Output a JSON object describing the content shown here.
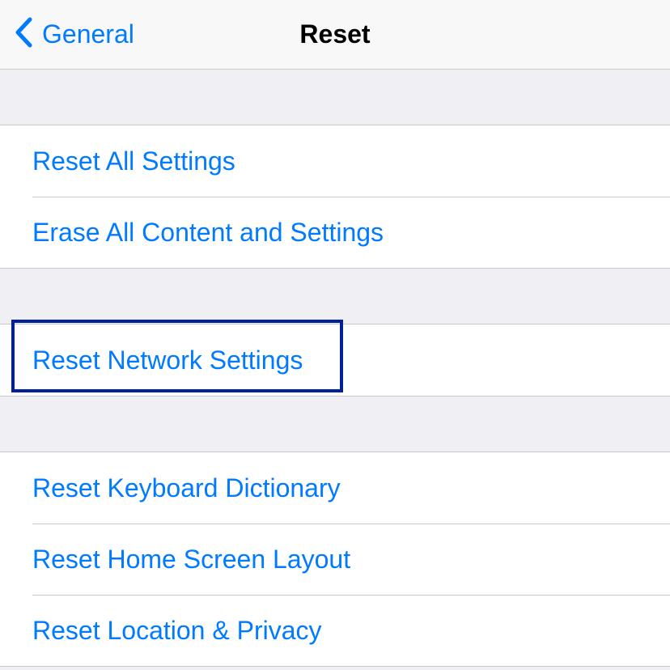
{
  "navbar": {
    "back_label": "General",
    "title": "Reset"
  },
  "groups": [
    {
      "items": [
        {
          "label": "Reset All Settings"
        },
        {
          "label": "Erase All Content and Settings"
        }
      ]
    },
    {
      "items": [
        {
          "label": "Reset Network Settings"
        }
      ]
    },
    {
      "items": [
        {
          "label": "Reset Keyboard Dictionary"
        },
        {
          "label": "Reset Home Screen Layout"
        },
        {
          "label": "Reset Location & Privacy"
        }
      ]
    }
  ]
}
